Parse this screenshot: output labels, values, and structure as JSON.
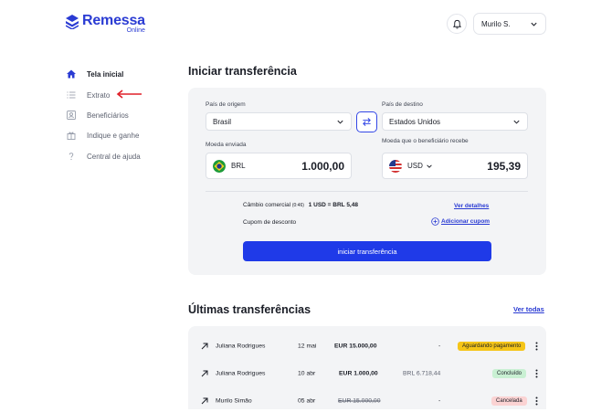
{
  "logo": {
    "name": "Remessa",
    "sub": "Online"
  },
  "header": {
    "user_name": "Murilo S."
  },
  "sidebar": {
    "items": [
      {
        "label": "Tela inicial",
        "icon": "home-icon",
        "active": true
      },
      {
        "label": "Extrato",
        "icon": "list-icon",
        "active": false
      },
      {
        "label": "Beneficiários",
        "icon": "contacts-icon",
        "active": false
      },
      {
        "label": "Indique e ganhe",
        "icon": "gift-icon",
        "active": false
      },
      {
        "label": "Central de ajuda",
        "icon": "help-icon",
        "active": false
      }
    ]
  },
  "transfer": {
    "title": "Iniciar transferência",
    "origin_label": "País de origem",
    "origin_value": "Brasil",
    "dest_label": "País de destino",
    "dest_value": "Estados Unidos",
    "sent_label": "Moeda enviada",
    "sent_currency": "BRL",
    "sent_amount": "1.000,00",
    "recv_label": "Moeda que o beneficiário recebe",
    "recv_currency": "USD",
    "recv_amount": "195,39",
    "rate_label": "Câmbio comercial",
    "rate_time": "(0:46)",
    "rate_value": "1 USD = BRL 5,48",
    "rate_link": "Ver detalhes",
    "coupon_label": "Cupom de desconto",
    "coupon_link": "Adicionar cupom",
    "submit_label": "iniciar transferência"
  },
  "recent": {
    "title": "Últimas transferências",
    "see_all": "Ver todas",
    "rows": [
      {
        "name": "Juliana Rodrigues",
        "date": "12 mai",
        "amount": "EUR 15.000,00",
        "converted": "-",
        "status": "Aguardando pagamento",
        "status_color": "#f5c518",
        "strike": false
      },
      {
        "name": "Juliana Rodrigues",
        "date": "10 abr",
        "amount": "EUR 1.000,00",
        "converted": "BRL 6.718,44",
        "status": "Concluído",
        "status_color": "#c9f0d3",
        "strike": false
      },
      {
        "name": "Murilo Simão",
        "date": "05 abr",
        "amount": "EUR 15.000,00",
        "converted": "-",
        "status": "Cancelada",
        "status_color": "#fbd3d3",
        "strike": true
      }
    ]
  },
  "colors": {
    "brand": "#2a3bd3",
    "button": "#1f3ae8",
    "annotation_arrow": "#e0202a"
  }
}
